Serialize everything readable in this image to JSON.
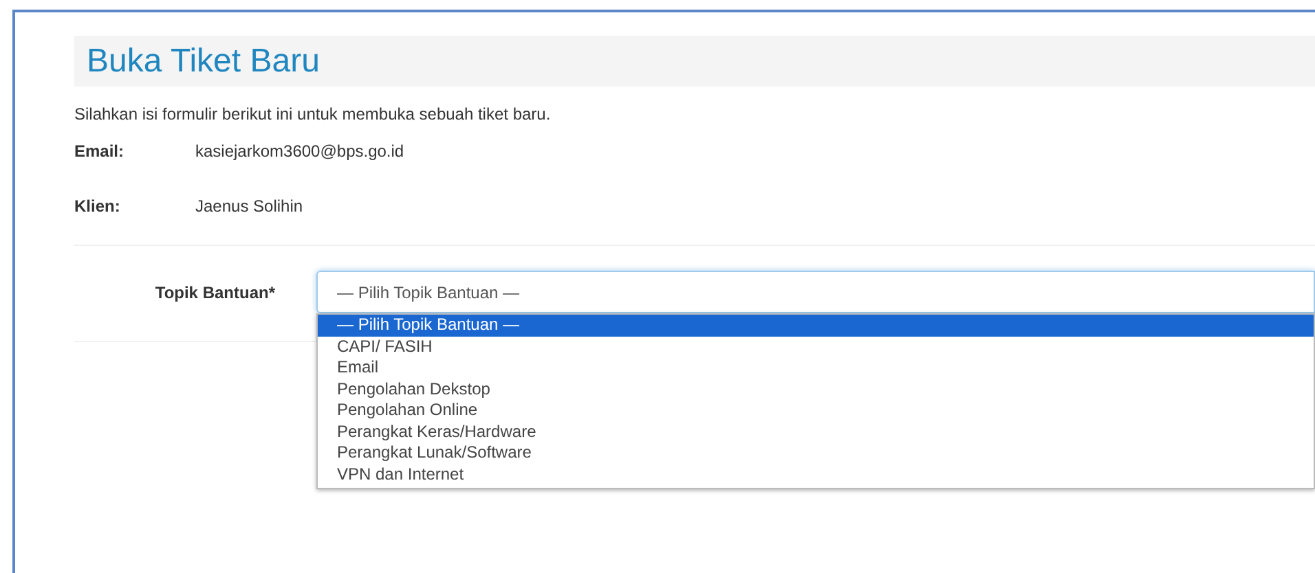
{
  "page": {
    "title": "Buka Tiket Baru",
    "description": "Silahkan isi formulir berikut ini untuk membuka sebuah tiket baru."
  },
  "info": [
    {
      "label": "Email:",
      "value": "kasiejarkom3600@bps.go.id"
    },
    {
      "label": "Klien:",
      "value": "Jaenus Solihin"
    }
  ],
  "topic_select": {
    "label": "Topik Bantuan*",
    "value": "— Pilih Topik Bantuan —",
    "expanded": true,
    "options": [
      {
        "label": "— Pilih Topik Bantuan —",
        "selected": true
      },
      {
        "label": "CAPI/ FASIH",
        "selected": false
      },
      {
        "label": "Email",
        "selected": false
      },
      {
        "label": "Pengolahan Dekstop",
        "selected": false
      },
      {
        "label": "Pengolahan Online",
        "selected": false
      },
      {
        "label": "Perangkat Keras/Hardware",
        "selected": false
      },
      {
        "label": "Perangkat Lunak/Software",
        "selected": false
      },
      {
        "label": "VPN dan Internet",
        "selected": false
      }
    ]
  }
}
